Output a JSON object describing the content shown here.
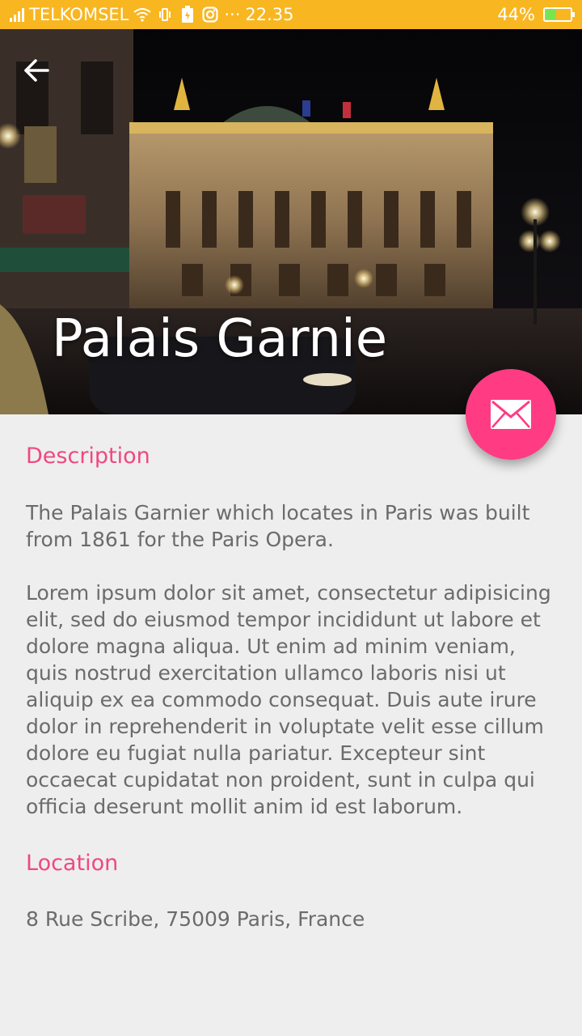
{
  "status_bar": {
    "carrier": "TELKOMSEL",
    "time": "22.35",
    "more": "···",
    "battery_percent": "44%",
    "battery_level": 0.44,
    "icons": [
      "signal-icon",
      "wifi-icon",
      "vibrate-icon",
      "battery-saver-icon",
      "instagram-icon"
    ]
  },
  "hero": {
    "title": "Palais Garnie",
    "back_icon": "arrow-left-icon"
  },
  "fab": {
    "icon": "email-icon",
    "color": "#ff3b83"
  },
  "description": {
    "title": "Description",
    "paragraph1": "The Palais Garnier which locates in Paris was built from 1861 for the Paris Opera.",
    "paragraph2": "Lorem ipsum dolor sit amet, consectetur adipisicing elit, sed do eiusmod tempor incididunt ut labore et dolore magna aliqua. Ut enim ad minim veniam, quis nostrud exercitation ullamco laboris nisi ut aliquip ex ea commodo consequat. Duis aute irure dolor in reprehenderit in voluptate velit esse cillum dolore eu fugiat nulla pariatur. Excepteur sint occaecat cupidatat non proident, sunt in culpa qui officia deserunt mollit anim id est laborum."
  },
  "location": {
    "title": "Location",
    "address": "8 Rue Scribe, 75009 Paris, France"
  },
  "colors": {
    "status_bar": "#f8b621",
    "accent": "#f0487f",
    "body_text": "#6b6b6b",
    "background": "#eeeeee"
  }
}
